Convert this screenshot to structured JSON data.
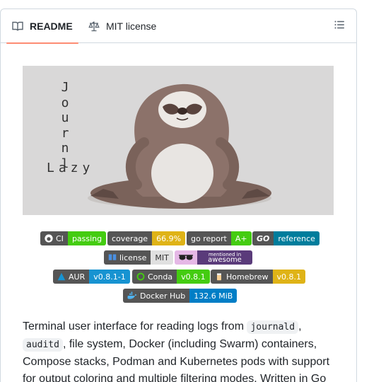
{
  "tabs": {
    "readme": "README",
    "license": "MIT license"
  },
  "hero": {
    "vertical_text": "Journl",
    "horizontal_text": "Lazy"
  },
  "badges": {
    "ci": {
      "label": "CI",
      "value": "passing",
      "color": "#4c1"
    },
    "coverage": {
      "label": "coverage",
      "value": "66.9%",
      "color": "#dfb317"
    },
    "goreport": {
      "label": "go report",
      "value": "A+",
      "color": "#4c1"
    },
    "goref": {
      "label": "GO",
      "value": "reference",
      "color": "#007d9c"
    },
    "license": {
      "label": "license",
      "value": "MIT",
      "color": "#e0e0e0"
    },
    "awesome": {
      "top": "mentioned in",
      "bottom": "awesome",
      "color": "#5a3b7a"
    },
    "aur": {
      "label": "AUR",
      "value": "v0.8.1-1",
      "color": "#1793d1"
    },
    "conda": {
      "label": "Conda",
      "value": "v0.8.1",
      "color": "#4c1"
    },
    "homebrew": {
      "label": "Homebrew",
      "value": "v0.8.1",
      "color": "#dfb317"
    },
    "docker": {
      "label": "Docker Hub",
      "value": "132.6 MiB",
      "color": "#007ec6"
    }
  },
  "description": {
    "part1": "Terminal user interface for reading logs from ",
    "code1": "journald",
    "part2": ", ",
    "code2": "auditd",
    "part3": ", file system, Docker (including Swarm) containers, Compose stacks, Podman and Kubernetes pods with support for output coloring and multiple filtering modes. Written in Go"
  }
}
